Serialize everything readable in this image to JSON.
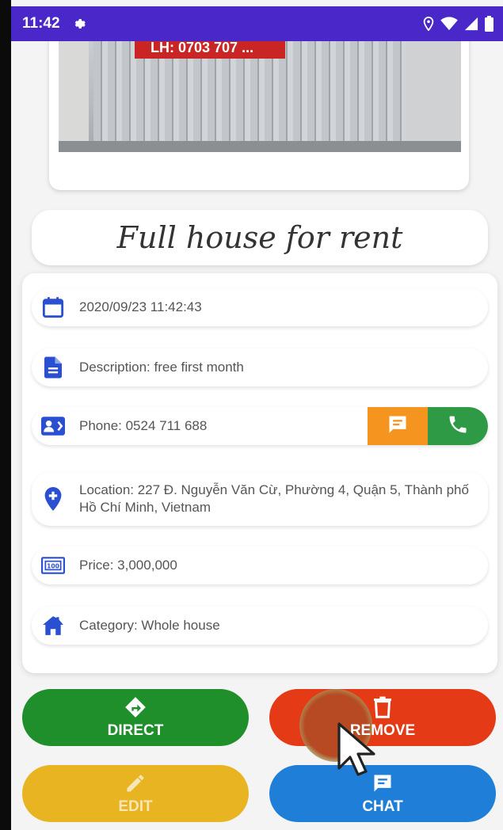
{
  "status_bar": {
    "time": "11:42"
  },
  "listing": {
    "title": "Full house for rent",
    "photo_sign": "LH: 0703 707 ..."
  },
  "details": {
    "date": "2020/09/23 11:42:43",
    "description": "Description: free first month",
    "phone": "Phone: 0524 711 688",
    "location": "Location: 227 Đ. Nguyễn Văn Cừ, Phường 4, Quận 5, Thành phố Hồ Chí Minh, Vietnam",
    "price": "Price: 3,000,000",
    "category": "Category: Whole house"
  },
  "actions": {
    "direct": "DIRECT",
    "remove": "REMOVE",
    "edit": "EDIT",
    "chat": "CHAT"
  },
  "colors": {
    "status_bar": "#4a27c9",
    "icon_blue": "#2a4fd0",
    "direct": "#1f8f2b",
    "remove": "#e53a16",
    "edit": "#e8b422",
    "chat": "#1e7ed8",
    "message": "#f5941f",
    "call": "#2e9a46"
  }
}
